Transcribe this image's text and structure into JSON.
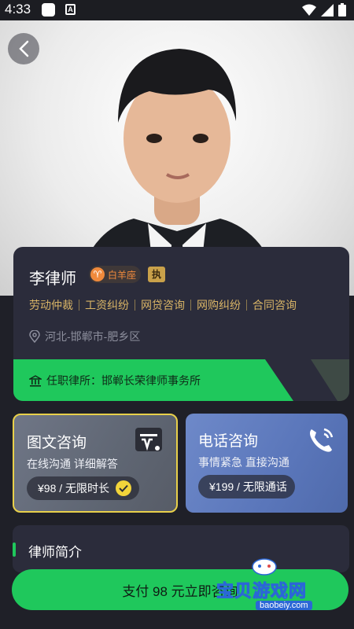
{
  "status_bar": {
    "time": "4:33"
  },
  "hero": {
    "back_icon": "chevron-left-icon"
  },
  "lawyer": {
    "name": "李律师",
    "zodiac": "白羊座",
    "cert_badge": "执",
    "specialties": [
      "劳动仲裁",
      "工资纠纷",
      "网贷咨询",
      "网购纠纷",
      "合同咨询"
    ],
    "location": "河北-邯郸市-肥乡区",
    "firm": "任职律所：邯郸长荣律师事务所"
  },
  "consult": {
    "text": {
      "title": "图文咨询",
      "subtitle": "在线沟通 详细解答",
      "price": "¥98 / 无限时长",
      "selected": true
    },
    "phone": {
      "title": "电话咨询",
      "subtitle": "事情紧急 直接沟通",
      "price": "¥199 / 无限通话"
    }
  },
  "intro": {
    "title": "律师简介"
  },
  "pay_button": {
    "label": "支付 98 元立即咨询"
  },
  "watermark": {
    "text": "宝贝游戏网",
    "url": "baobeiy.com"
  },
  "colors": {
    "accent_green": "#1fc85c",
    "gold": "#d8b466",
    "selected_border": "#e8d04a"
  }
}
